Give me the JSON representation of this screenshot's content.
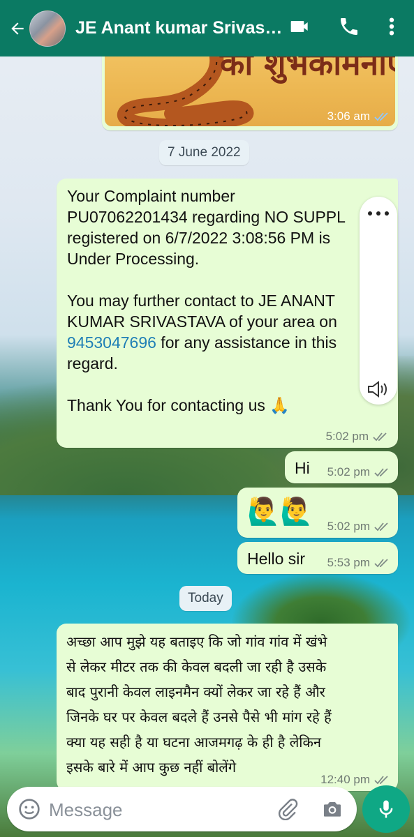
{
  "header": {
    "contact_name": "JE Anant kumar Srivast...",
    "icons": [
      "back-arrow-icon",
      "avatar",
      "video-call-icon",
      "phone-icon",
      "more-vert-icon"
    ]
  },
  "messages": [
    {
      "type": "image",
      "direction": "outgoing",
      "banner_text": "का शुभकामनाएं",
      "time": "3:06 am",
      "status": "read"
    },
    {
      "type": "date",
      "label": "7 June 2022"
    },
    {
      "type": "text",
      "direction": "incoming",
      "text": "Your Complaint number\nPU07062201434 regarding NO SUPPL\nregistered on 6/7/2022 3:08:56 PM is\nUnder Processing.\n\nYou may further contact to JE ANANT\nKUMAR SRIVASTAVA of your area on",
      "phone": "9453047696",
      "text_after_phone": " for any assistance in this\nregard.\n\nThank You for contacting us 🙏",
      "time": "5:02 pm",
      "status": "read"
    },
    {
      "type": "text",
      "direction": "outgoing",
      "text": "Hi",
      "time": "5:02 pm",
      "status": "read"
    },
    {
      "type": "text",
      "direction": "outgoing",
      "text": "🙋‍♂️🙋‍♂️",
      "time": "5:02 pm",
      "status": "read"
    },
    {
      "type": "text",
      "direction": "outgoing",
      "text": "Hello sir",
      "time": "5:53 pm",
      "status": "read"
    },
    {
      "type": "date",
      "label": "Today"
    },
    {
      "type": "text",
      "direction": "outgoing",
      "text": "अच्छा आप मुझे यह बताइए कि जो गांव गांव में खंभे\nसे लेकर मीटर तक की केवल बदली जा रही है उसके\nबाद पुरानी केवल लाइनमैन क्यों लेकर जा रहे हैं और\nजिनके घर पर केवल बदले हैं उनसे पैसे भी मांग रहे हैं\nक्या यह सही है या घटना आजमगढ़ के ही है लेकिन\nइसके बारे में आप कुछ नहीं बोलेंगे",
      "time": "12:40 pm",
      "status": "read"
    }
  ],
  "composer": {
    "placeholder": "Message",
    "icons": [
      "emoji-icon",
      "attach-icon",
      "camera-icon",
      "mic-icon"
    ]
  },
  "colors": {
    "header": "#0b7a63",
    "bubble": "#e7fdd5",
    "link": "#1f7fb6",
    "mic_button": "#0fa885"
  }
}
